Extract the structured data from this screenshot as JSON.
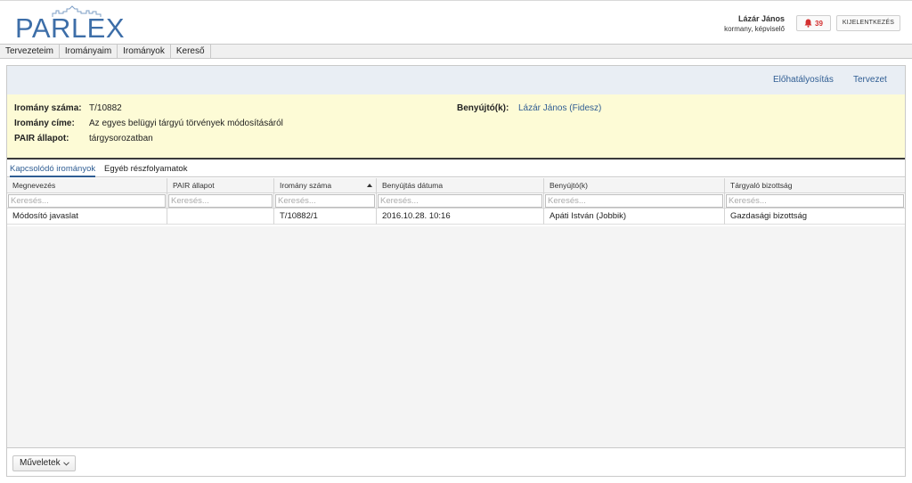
{
  "header": {
    "logo_text": "PARLEX",
    "user_name": "Lázár János",
    "user_role": "kormany, képviselő",
    "notification_count": "39",
    "logout_label": "KIJELENTKEZÉS"
  },
  "menu": {
    "items": [
      {
        "label": "Tervezeteim"
      },
      {
        "label": "Irományaim"
      },
      {
        "label": "Irományok"
      },
      {
        "label": "Kereső"
      }
    ]
  },
  "toolbar": {
    "preview_label": "Előhatályosítás",
    "draft_label": "Tervezet"
  },
  "info": {
    "number_label": "Iromány száma:",
    "number_value": "T/10882",
    "title_label": "Iromány címe:",
    "title_value": "Az egyes belügyi tárgyú törvények módosításáról",
    "status_label": "PAIR állapot:",
    "status_value": "tárgysorozatban",
    "submitter_label": "Benyújtó(k):",
    "submitter_value": "Lázár János (Fidesz)"
  },
  "tabs": [
    {
      "label": "Kapcsolódó irományok"
    },
    {
      "label": "Egyéb részfolyamatok"
    }
  ],
  "grid": {
    "columns": [
      {
        "label": "Megnevezés"
      },
      {
        "label": "PAIR állapot"
      },
      {
        "label": "Iromány száma"
      },
      {
        "label": "Benyújtás dátuma"
      },
      {
        "label": "Benyújtó(k)"
      },
      {
        "label": "Tárgyaló bizottság"
      }
    ],
    "filter_placeholder": "Keresés...",
    "rows": [
      [
        "Módosító javaslat",
        "",
        "T/10882/1",
        "2016.10.28. 10:16",
        "Apáti István (Jobbik)",
        "Gazdasági bizottság"
      ]
    ]
  },
  "footer": {
    "actions_label": "Műveletek"
  },
  "colors": {
    "brand": "#3d6ea8",
    "link": "#2f5d93",
    "info_background": "#fdfbd6",
    "notification": "#d32f2f"
  }
}
